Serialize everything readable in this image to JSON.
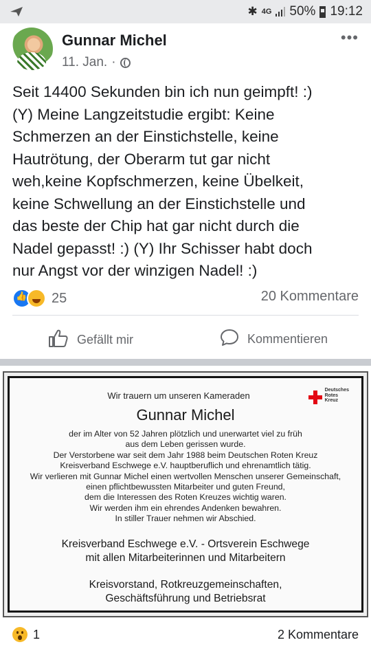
{
  "status_bar": {
    "network": "4G",
    "battery": "50%",
    "time": "19:12",
    "icons": [
      "send-icon",
      "bluetooth-icon",
      "signal-icon",
      "battery-icon"
    ]
  },
  "post": {
    "author": "Gunnar Michel",
    "date": "11. Jan.",
    "separator": "·",
    "text": "Seit 14400 Sekunden bin ich nun geimpft! :)\n(Y) Meine Langzeitstudie ergibt: Keine\nSchmerzen an der Einstichstelle, keine\nHautrötung, der Oberarm tut gar nicht\nweh,keine Kopfschmerzen, keine Übelkeit,\nkeine Schwellung an der Einstichstelle und\ndas beste der Chip hat gar nicht durch die\nNadel gepasst! :) (Y) Ihr Schisser habt doch\nnur Angst vor der winzigen Nadel! :)",
    "reaction_count": "25",
    "comments": "20 Kommentare",
    "actions": {
      "like": "Gefällt mir",
      "comment": "Kommentieren"
    }
  },
  "obituary": {
    "intro": "Wir trauern um unseren Kameraden",
    "name": "Gunnar Michel",
    "body": "der im Alter von 52 Jahren plötzlich und unerwartet viel zu früh\naus dem Leben gerissen wurde.\nDer Verstorbene war seit dem Jahr 1988 beim Deutschen Roten Kreuz\nKreisverband Eschwege e.V. hauptberuflich und ehrenamtlich tätig.\nWir verlieren mit Gunnar Michel einen wertvollen Menschen unserer Gemeinschaft,\neinen pflichtbewussten Mitarbeiter und guten Freund,\ndem die Interessen des Roten Kreuzes wichtig waren.\nWir werden ihm ein ehrendes Andenken bewahren.\nIn stiller Trauer nehmen wir Abschied.",
    "organization": "Kreisverband Eschwege e.V. - Ortsverein Eschwege\nmit allen Mitarbeiterinnen und Mitarbeitern",
    "board": "Kreisvorstand, Rotkreuzgemeinschaften,\nGeschäftsführung und Betriebsrat",
    "logo_text": "Deutsches\nRotes\nKreuz",
    "logo_color": "#e30613"
  },
  "footer": {
    "reaction_count": "1",
    "comments": "2 Kommentare"
  },
  "colors": {
    "facebook_blue": "#1877f2",
    "text_secondary": "#65676b",
    "reaction_yellow": "#f7b928"
  }
}
